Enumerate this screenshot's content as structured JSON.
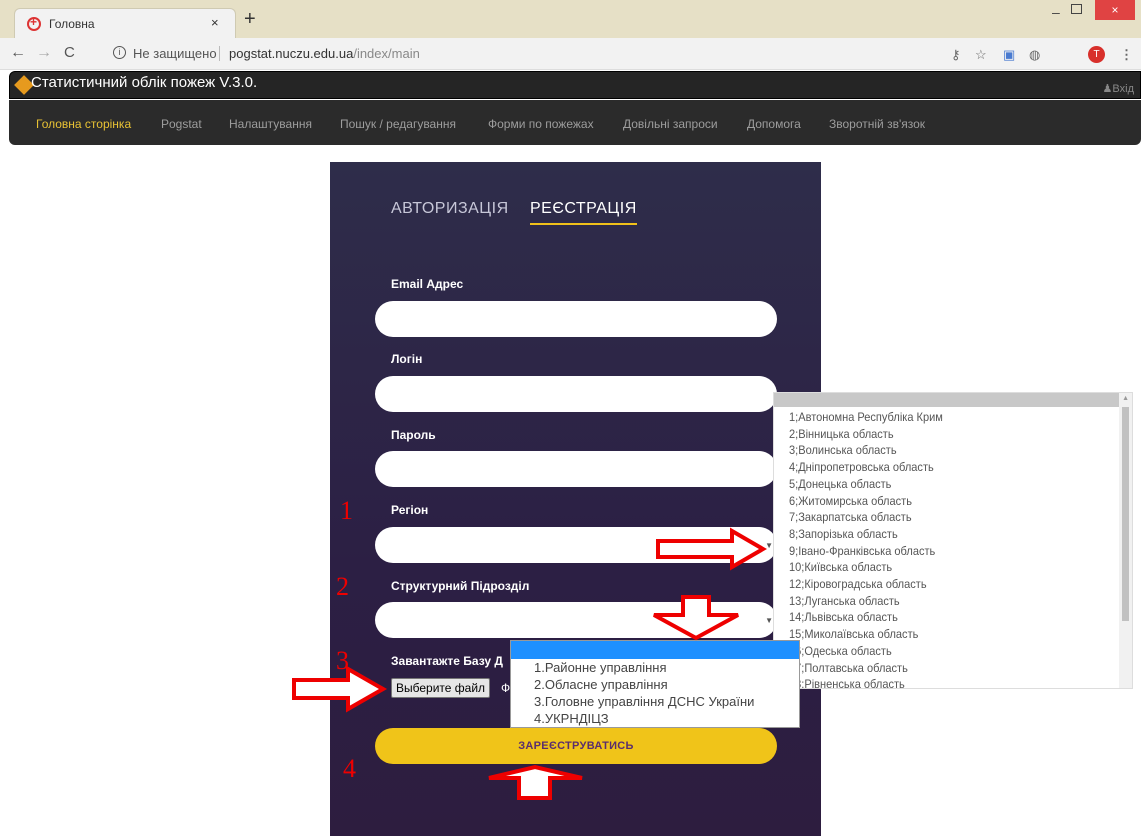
{
  "browser": {
    "tab_title": "Головна",
    "tab_close": "×",
    "new_tab": "+",
    "url_security": "Не защищено",
    "url_host": "pogstat.nuczu.edu.ua",
    "url_path": "/index/main",
    "avatar_letter": "T",
    "win_min": "–",
    "win_close": "×"
  },
  "app": {
    "title": "Статистичний облік пожеж V.3.0.",
    "login": "Вхід"
  },
  "nav": {
    "items": [
      "Головна сторінка",
      "Pogstat",
      "Налаштування",
      "Пошук / редагування",
      "Форми по пожежах",
      "Довільні запроси",
      "Допомога",
      "Зворотній зв'язок"
    ]
  },
  "form": {
    "tab_auth": "АВТОРИЗАЦІЯ",
    "tab_reg": "РЕЄСТРАЦІЯ",
    "email_label": "Email Адрес",
    "login_label": "Логін",
    "password_label": "Пароль",
    "region_label": "Регіон",
    "subdivision_label": "Структурний Підрозділ",
    "upload_label": "Завантажте Базу Д",
    "file_button": "Выберите файл",
    "file_status": "Ф",
    "submit": "ЗАРЕЄСТРУВАТИСЬ"
  },
  "markers": [
    "1",
    "2",
    "3",
    "4"
  ],
  "region_options": [
    "1;Автономна Республіка Крим",
    "2;Вінницька область",
    "3;Волинська область",
    "4;Дніпропетровська область",
    "5;Донецька область",
    "6;Житомирська область",
    "7;Закарпатська область",
    "8;Запорізька область",
    "9;Івано-Франківська область",
    "10;Київська область",
    "12;Кіровоградська область",
    "13;Луганська область",
    "14;Львівська область",
    "15;Миколаївська область",
    "16;Одеська область",
    "17;Полтавська область",
    "18;Рівненська область"
  ],
  "subdivision_options": [
    "1.Районне управління",
    "2.Обласне управління",
    "3.Головне управління ДСНС України",
    "4.УКРНДІЦЗ"
  ],
  "colors": {
    "panel": "#2c1f44",
    "accent": "#f0c419",
    "annotation": "#e00000",
    "nav_active": "#e8c234"
  }
}
